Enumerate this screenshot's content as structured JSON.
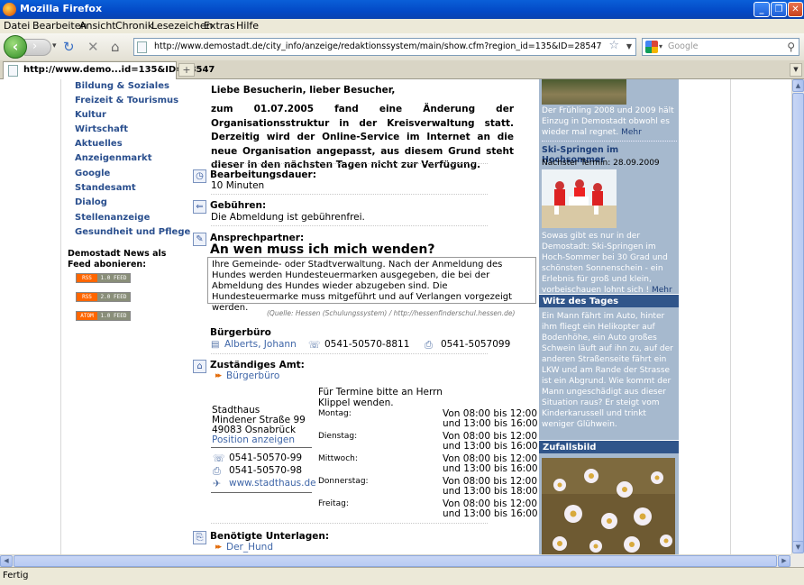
{
  "window": {
    "title": "Mozilla Firefox"
  },
  "menu": [
    "Datei",
    "Bearbeiten",
    "Ansicht",
    "Chronik",
    "Lesezeichen",
    "Extras",
    "Hilfe"
  ],
  "url": "http://www.demostadt.de/city_info/anzeige/redaktionssystem/main/show.cfm?region_id=135&ID=28547",
  "search_placeholder": "Google",
  "tab_title": "http://www.demo...id=135&ID=28547",
  "nav": [
    "Bildung & Soziales",
    "Freizeit & Tourismus",
    "Kultur",
    "Wirtschaft",
    "Aktuelles",
    "Anzeigenmarkt",
    "Google",
    "Standesamt",
    "Dialog",
    "Stellenanzeige",
    "Gesundheit und Pflege"
  ],
  "feeds": {
    "heading": "Demostadt News als Feed abonieren:",
    "buttons": [
      {
        "a": "RSS",
        "b": "1.0 FEED"
      },
      {
        "a": "RSS",
        "b": "2.0 FEED"
      },
      {
        "a": "ATOM",
        "b": "1.0 FEED"
      }
    ]
  },
  "main": {
    "greeting": "Liebe Besucherin, lieber Besucher,",
    "notice": "zum 01.07.2005 fand eine Änderung der Organisationsstruktur in der Kreisverwaltung statt. Derzeitig wird der Online-Service im Internet an die neue Organisation angepasst, aus diesem Grund steht dieser in den nächsten Tagen nicht zur Verfügung.",
    "duration_label": "Bearbeitungsdauer:",
    "duration_value": "10 Minuten",
    "fees_label": "Gebühren:",
    "fees_value": "Die Abmeldung ist gebührenfrei.",
    "contact_label": "Ansprechpartner:",
    "contact_question": "An wen muss ich mich wenden?",
    "contact_text": "Ihre Gemeinde- oder Stadtverwaltung. Nach der Anmeldung des Hundes werden Hundesteuermarken ausgegeben, die bei der Abmeldung des Hundes wieder abzugeben sind. Die Hundesteuermarke muss mitgeführt und auf Verlangen vorgezeigt werden.",
    "source": "(Quelle: Hessen (Schulungssystem) / http://hessenfinderschul.hessen.de)",
    "office_title": "Bürgerbüro",
    "office_person": "Alberts, Johann",
    "office_phone": "0541-50570-8811",
    "office_fax": "0541-5057099",
    "authority_label": "Zuständiges Amt:",
    "authority_link": "Bürgerbüro",
    "appointment": "Für Termine bitte an Herrn Klippel wenden.",
    "address": [
      "Stadthaus",
      "Mindener Straße 99",
      "49083 Osnabrück"
    ],
    "position_link": "Position anzeigen",
    "phone": "0541-50570-99",
    "fax": "0541-50570-98",
    "web": "www.stadthaus.de",
    "hours": [
      {
        "day": "Montag:",
        "l1": "Von 08:00 bis 12:00",
        "l2": "und 13:00 bis 16:00"
      },
      {
        "day": "Dienstag:",
        "l1": "Von 08:00 bis 12:00",
        "l2": "und 13:00 bis 16:00"
      },
      {
        "day": "Mittwoch:",
        "l1": "Von 08:00 bis 12:00",
        "l2": "und 13:00 bis 16:00"
      },
      {
        "day": "Donnerstag:",
        "l1": "Von 08:00 bis 12:00",
        "l2": "und 13:00 bis 18:00"
      },
      {
        "day": "Freitag:",
        "l1": "Von 08:00 bis 12:00",
        "l2": "und 13:00 bis 16:00"
      }
    ],
    "docs_label": "Benötigte Unterlagen:",
    "docs_link": "Der_Hund"
  },
  "right": {
    "spring_text": "Der Frühling 2008 und 2009 hält Einzug in Demostadt obwohl es wieder mal regnet.",
    "more": "Mehr",
    "ski_title": "Ski-Springen im Hochsommer",
    "ski_date": "Nächster Termin: 28.09.2009",
    "ski_text": "Sowas gibt es nur in der Demostadt: Ski-Springen im Hoch-Sommer bei 30 Grad und schönsten Sonnenschein - ein Erlebnis für groß und klein, vorbeischauen lohnt sich !",
    "joke_title": "Witz des Tages",
    "joke_text": "Ein Mann fährt im Auto, hinter ihm fliegt ein Helikopter auf Bodenhöhe, ein Auto großes Schwein läuft auf ihn zu, auf der anderen Straßenseite fährt ein LKW und am Rande der Strasse ist ein Abgrund. Wie kommt der Mann ungeschädigt aus dieser Situation raus? Er steigt vom Kinderkarussell und trinkt weniger Glühwein.",
    "random_title": "Zufallsbild"
  },
  "status": "Fertig",
  "colors": {
    "link": "#2a4f8e",
    "sidebar": "#a6b9ce",
    "sidebar_head": "#30558a",
    "accent_arrow": "#e36c0a"
  }
}
